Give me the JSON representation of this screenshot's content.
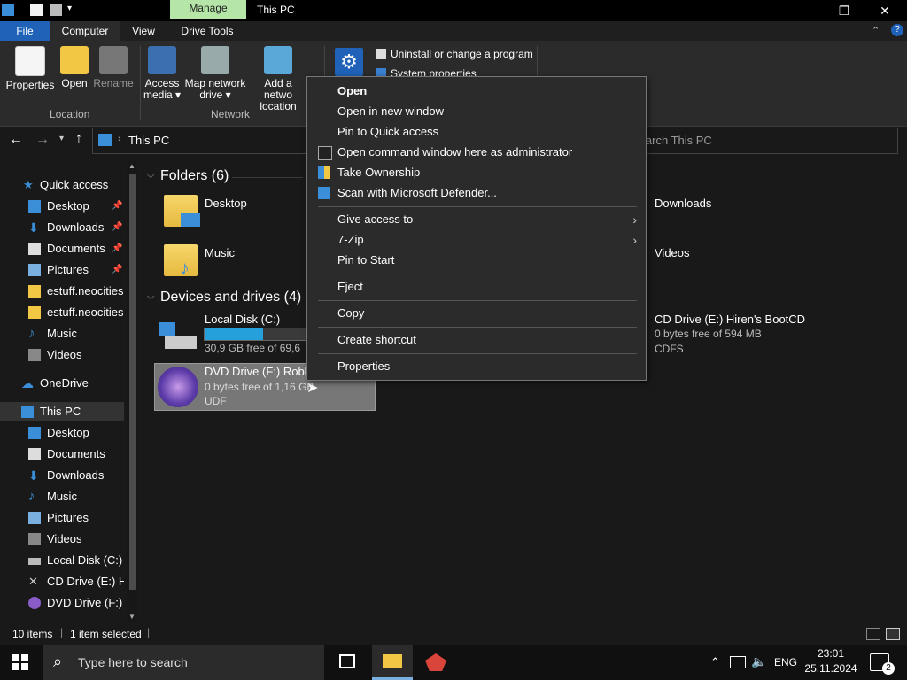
{
  "window": {
    "title": "This PC",
    "manage_tab": "Manage"
  },
  "ribbon": {
    "tabs": [
      "File",
      "Computer",
      "View",
      "Drive Tools"
    ],
    "location_group": {
      "label": "Location",
      "buttons": [
        "Properties",
        "Open",
        "Rename"
      ]
    },
    "network_group": {
      "label": "Network",
      "access_media": [
        "Access",
        "media ▾"
      ],
      "map_network_drive": [
        "Map network",
        "drive ▾"
      ],
      "add_network_location": [
        "Add a netwo",
        "location"
      ]
    },
    "system_group": {
      "uninstall": "Uninstall or change a program",
      "system_properties": "System properties"
    }
  },
  "navbar": {
    "address": "This PC",
    "search_placeholder": "Search This PC"
  },
  "sidebar": {
    "items": [
      {
        "label": "Quick access",
        "icon": "star-icon",
        "pinned": false
      },
      {
        "label": "Desktop",
        "icon": "desktop-icon",
        "pinned": true
      },
      {
        "label": "Downloads",
        "icon": "download-icon",
        "pinned": true
      },
      {
        "label": "Documents",
        "icon": "document-icon",
        "pinned": true
      },
      {
        "label": "Pictures",
        "icon": "pictures-icon",
        "pinned": true
      },
      {
        "label": "estuff.neocities",
        "icon": "folder-icon",
        "pinned": false
      },
      {
        "label": "estuff.neocities",
        "icon": "folder-icon",
        "pinned": false
      },
      {
        "label": "Music",
        "icon": "music-icon",
        "pinned": false
      },
      {
        "label": "Videos",
        "icon": "videos-icon",
        "pinned": false
      },
      {
        "label": "OneDrive",
        "icon": "cloud-icon",
        "pinned": false
      },
      {
        "label": "This PC",
        "icon": "computer-icon",
        "pinned": false
      },
      {
        "label": "Desktop",
        "icon": "desktop-icon",
        "pinned": false
      },
      {
        "label": "Documents",
        "icon": "document-icon",
        "pinned": false
      },
      {
        "label": "Downloads",
        "icon": "download-icon",
        "pinned": false
      },
      {
        "label": "Music",
        "icon": "music-icon",
        "pinned": false
      },
      {
        "label": "Pictures",
        "icon": "pictures-icon",
        "pinned": false
      },
      {
        "label": "Videos",
        "icon": "videos-icon",
        "pinned": false
      },
      {
        "label": "Local Disk (C:)",
        "icon": "disk-icon",
        "pinned": false
      },
      {
        "label": "CD Drive (E:) H",
        "icon": "tools-icon",
        "pinned": false
      },
      {
        "label": "DVD Drive (F:)",
        "icon": "dvd-icon",
        "pinned": false
      }
    ]
  },
  "content": {
    "folders_header": "Folders (6)",
    "folders": [
      "Desktop",
      "Downloads",
      "Music",
      "Videos"
    ],
    "drives_header": "Devices and drives (4)",
    "drives": {
      "local_c": {
        "name": "Local Disk (C:)",
        "free": "30,9 GB free of 69,6",
        "used_fraction": 0.56
      },
      "dvd_f": {
        "name": "DVD Drive (F:) Roblo",
        "free": "0 bytes free of 1,16 GB",
        "fs": "UDF"
      },
      "cd_e": {
        "name": "CD Drive (E:) Hiren's BootCD",
        "free": "0 bytes free of 594 MB",
        "fs": "CDFS"
      }
    }
  },
  "context_menu": {
    "items": [
      {
        "label": "Open",
        "bold": true
      },
      {
        "label": "Open in new window"
      },
      {
        "label": "Pin to Quick access"
      },
      {
        "label": "Open command window here as administrator",
        "icon": "cmd-icon"
      },
      {
        "label": "Take Ownership",
        "icon": "shield-icon"
      },
      {
        "label": "Scan with Microsoft Defender...",
        "icon": "defender-icon"
      },
      {
        "label": "Give access to",
        "submenu": true
      },
      {
        "label": "7-Zip",
        "submenu": true
      },
      {
        "label": "Pin to Start"
      },
      {
        "label": "Eject"
      },
      {
        "label": "Copy"
      },
      {
        "label": "Create shortcut"
      },
      {
        "label": "Properties"
      }
    ]
  },
  "status": {
    "items_count": "10 items",
    "selected": "1 item selected"
  },
  "taskbar": {
    "search_placeholder": "Type here to search",
    "language": "ENG",
    "time": "23:01",
    "date": "25.11.2024",
    "notifications": "2"
  },
  "colors": {
    "accent": "#1f62b8",
    "manage_tab": "#b5e6a8",
    "progress": "#26a0da"
  }
}
